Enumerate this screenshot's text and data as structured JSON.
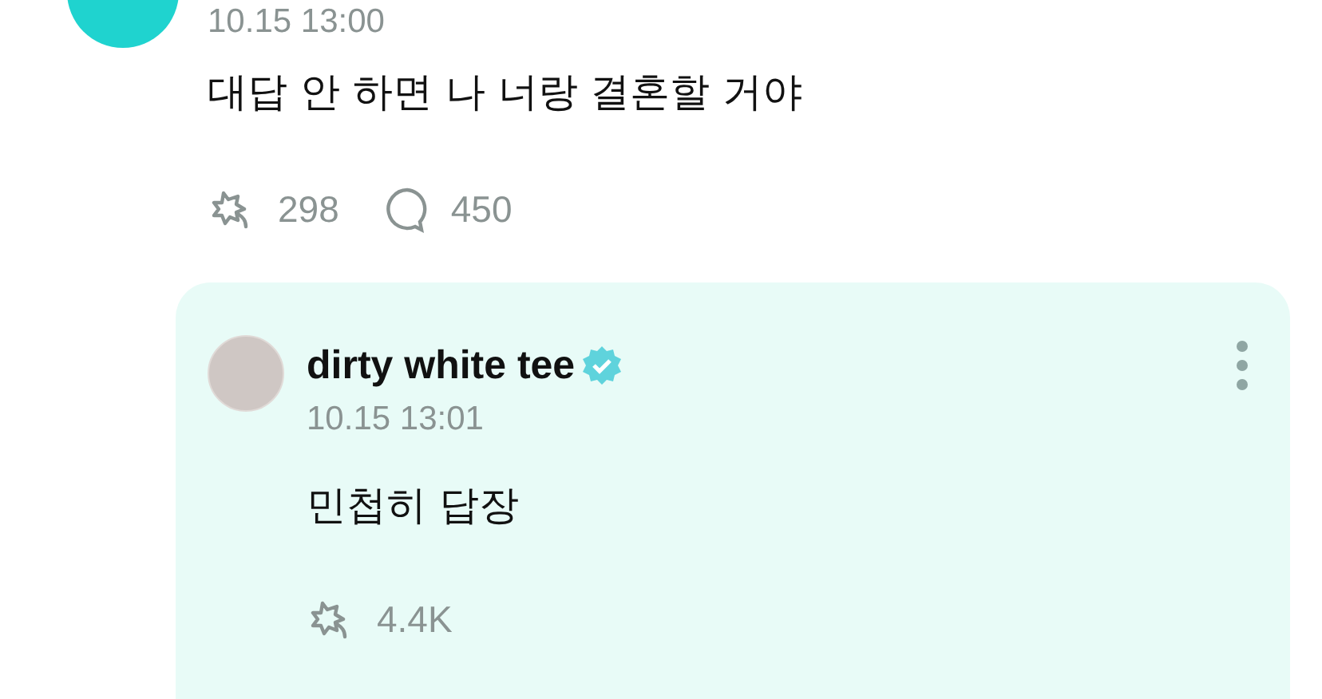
{
  "post": {
    "time": "10.15 13:00",
    "text": "대답 안 하면 나 너랑 결혼할 거야",
    "likes": "298",
    "comments": "450"
  },
  "reply": {
    "name": "dirty white tee",
    "verified": true,
    "time": "10.15 13:01",
    "text": "민첩히 답장",
    "likes": "4.4K"
  }
}
